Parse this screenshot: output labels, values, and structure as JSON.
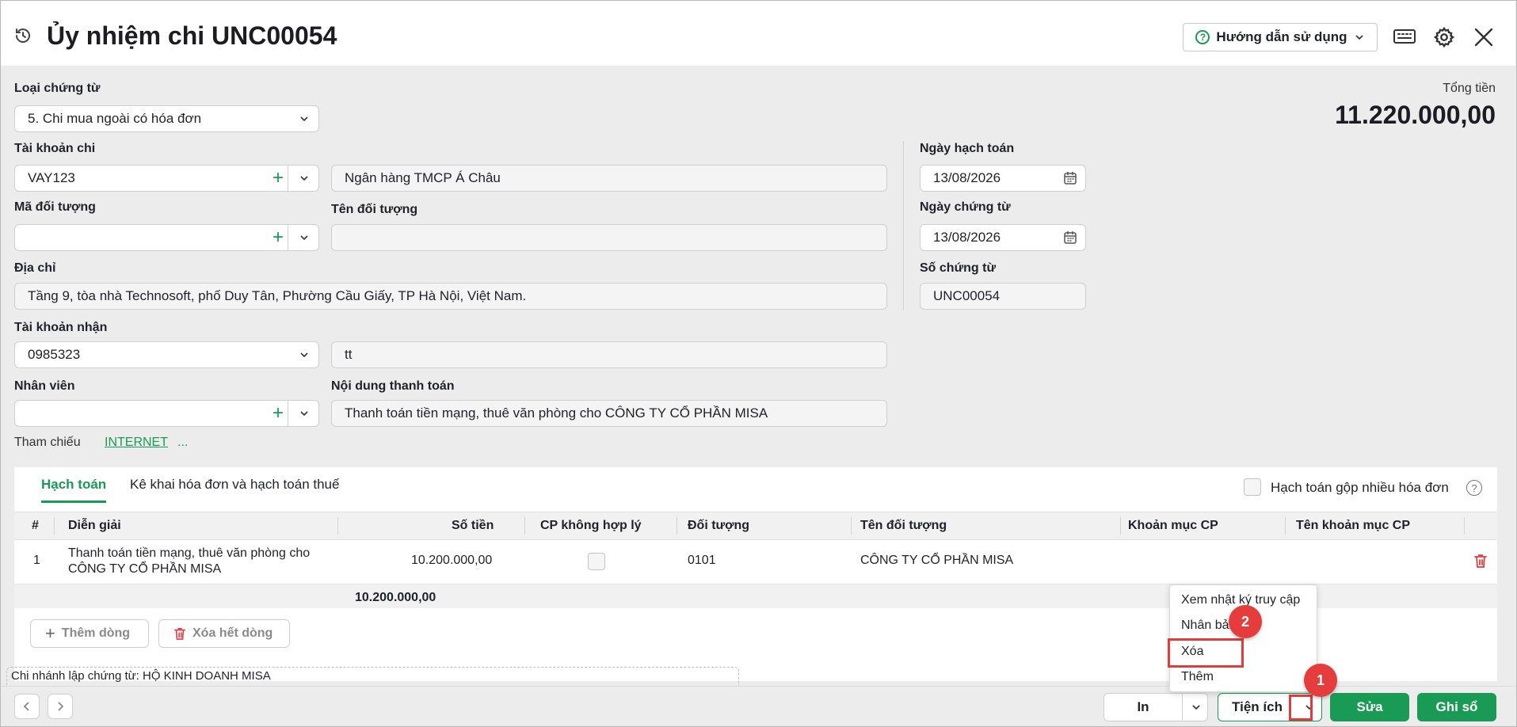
{
  "header": {
    "title": "Ủy nhiệm chi UNC00054",
    "help_label": "Hướng dẫn sử dụng"
  },
  "form": {
    "voucher_type_label": "Loại chứng từ",
    "voucher_type_value": "5. Chi mua ngoài có hóa đơn",
    "pay_account_label": "Tài khoản chi",
    "pay_account_value": "VAY123",
    "bank_name_value": "Ngân hàng TMCP Á Châu",
    "object_code_label": "Mã đối tượng",
    "object_code_value": "",
    "object_name_label": "Tên đối tượng",
    "object_name_value": "",
    "address_label": "Địa chỉ",
    "address_value": "Tầng 9, tòa nhà Technosoft, phố Duy Tân, Phường Cầu Giấy, TP Hà Nội, Việt Nam.",
    "receive_account_label": "Tài khoản nhận",
    "receive_account_value": "0985323",
    "receive_bank_value": "tt",
    "employee_label": "Nhân viên",
    "employee_value": "",
    "payment_content_label": "Nội dung thanh toán",
    "payment_content_value": "Thanh toán tiền mạng, thuê văn phòng cho CÔNG TY CỔ PHẦN MISA",
    "posting_date_label": "Ngày hạch toán",
    "posting_date_value": "13/08/2026",
    "voucher_date_label": "Ngày chứng từ",
    "voucher_date_value": "13/08/2026",
    "voucher_no_label": "Số chứng từ",
    "voucher_no_value": "UNC00054",
    "total_label": "Tổng tiền",
    "total_value": "11.220.000,00",
    "reference_label": "Tham chiếu",
    "reference_link": "INTERNET",
    "reference_more": "..."
  },
  "detail": {
    "tabs": [
      "Hạch toán",
      "Kê khai hóa đơn và hạch toán thuế"
    ],
    "merge_invoices_label": "Hạch toán gộp nhiều hóa đơn",
    "columns": [
      "#",
      "Diễn giải",
      "Số tiền",
      "CP không hợp lý",
      "Đối tượng",
      "Tên đối tượng",
      "Khoản mục CP",
      "Tên khoản mục CP"
    ],
    "rows": [
      {
        "index": "1",
        "description_line1": "Thanh toán tiền mạng, thuê văn phòng cho",
        "description_line2": "CÔNG TY CỔ PHẦN MISA",
        "amount": "10.200.000,00",
        "object": "0101",
        "object_name": "CÔNG TY CỔ PHẦN MISA"
      }
    ],
    "sum_amount": "10.200.000,00",
    "add_row_label": "Thêm dòng",
    "delete_all_label": "Xóa hết dòng"
  },
  "branch_text": "Chi nhánh lập chứng từ: HỘ KINH DOANH MISA",
  "footer": {
    "print_label": "In",
    "utilities_label": "Tiện ích",
    "edit_label": "Sửa",
    "post_label": "Ghi sổ"
  },
  "menu": {
    "items": [
      "Xem nhật ký truy cập",
      "Nhân bản",
      "Xóa",
      "Thêm"
    ]
  },
  "steps": [
    "1",
    "2"
  ],
  "colors": {
    "accent_green": "#1a9b55",
    "highlight_red": "#e03c3c"
  }
}
